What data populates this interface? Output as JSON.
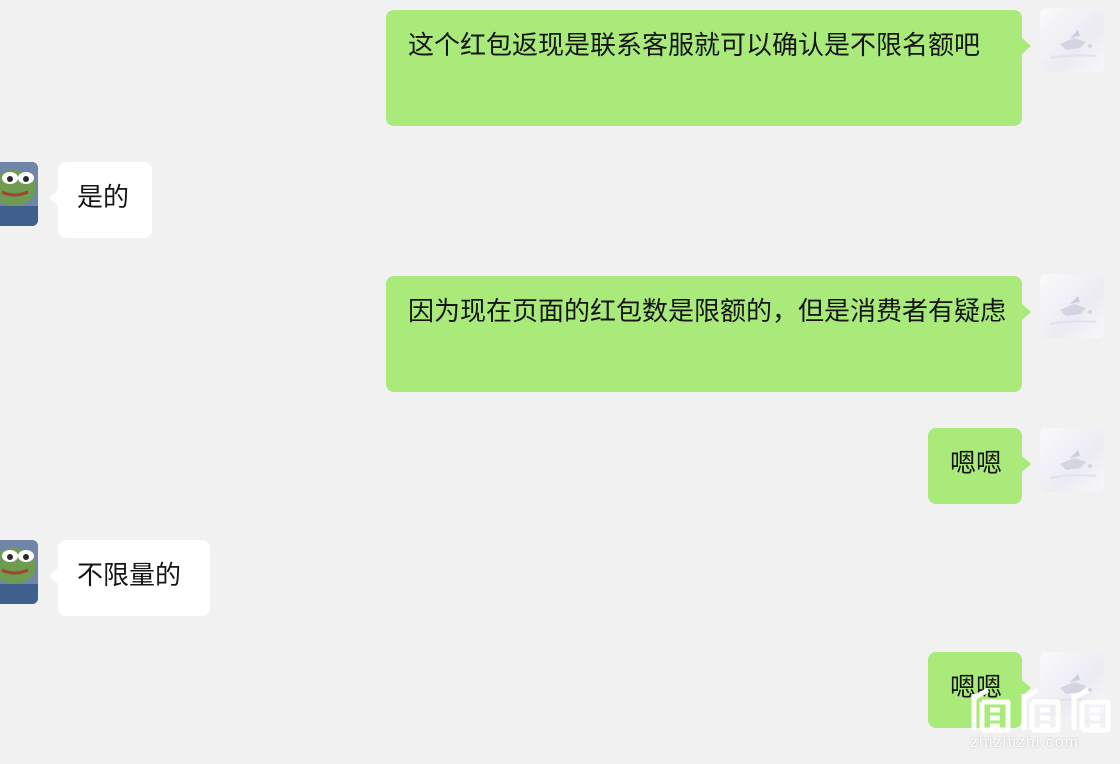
{
  "messages": [
    {
      "side": "sent",
      "text": "这个红包返现是联系客服就可以确认是不限名额吧"
    },
    {
      "side": "recv",
      "text": "是的"
    },
    {
      "side": "sent",
      "text": "因为现在页面的红包数是限额的，但是消费者有疑虑"
    },
    {
      "side": "sent",
      "text": "嗯嗯"
    },
    {
      "side": "recv",
      "text": "不限量的"
    },
    {
      "side": "sent",
      "text": "嗯嗯"
    }
  ],
  "watermark": {
    "text": "zhizhizhi.com",
    "logo_icon": "zhizhizhi-logo-icon"
  },
  "colors": {
    "background": "#f1f1f1",
    "sent_bubble": "#a9ea7a",
    "received_bubble": "#ffffff"
  }
}
